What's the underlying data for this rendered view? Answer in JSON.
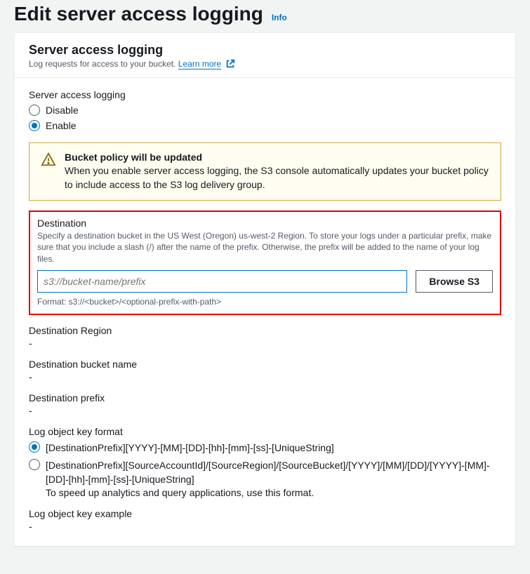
{
  "header": {
    "title": "Edit server access logging",
    "info": "Info"
  },
  "panel": {
    "title": "Server access logging",
    "subtitle": "Log requests for access to your bucket.",
    "learn_more": "Learn more"
  },
  "logging_toggle": {
    "label": "Server access logging",
    "disable": "Disable",
    "enable": "Enable"
  },
  "alert": {
    "title": "Bucket policy will be updated",
    "text": "When you enable server access logging, the S3 console automatically updates your bucket policy to include access to the S3 log delivery group."
  },
  "destination": {
    "title": "Destination",
    "desc": "Specify a destination bucket in the US West (Oregon) us-west-2 Region. To store your logs under a particular prefix, make sure that you include a slash (/) after the name of the prefix. Otherwise, the prefix will be added to the name of your log files.",
    "placeholder": "s3://bucket-name/prefix",
    "browse": "Browse S3",
    "format_hint": "Format: s3://<bucket>/<optional-prefix-with-path>"
  },
  "dest_region": {
    "label": "Destination Region",
    "value": "-"
  },
  "dest_bucket": {
    "label": "Destination bucket name",
    "value": "-"
  },
  "dest_prefix": {
    "label": "Destination prefix",
    "value": "-"
  },
  "key_format": {
    "label": "Log object key format",
    "opt1": "[DestinationPrefix][YYYY]-[MM]-[DD]-[hh]-[mm]-[ss]-[UniqueString]",
    "opt2": "[DestinationPrefix][SourceAccountId]/[SourceRegion]/[SourceBucket]/[YYYY]/[MM]/[DD]/[YYYY]-[MM]-[DD]-[hh]-[mm]-[ss]-[UniqueString]",
    "opt2_hint": "To speed up analytics and query applications, use this format."
  },
  "key_example": {
    "label": "Log object key example",
    "value": "-"
  }
}
